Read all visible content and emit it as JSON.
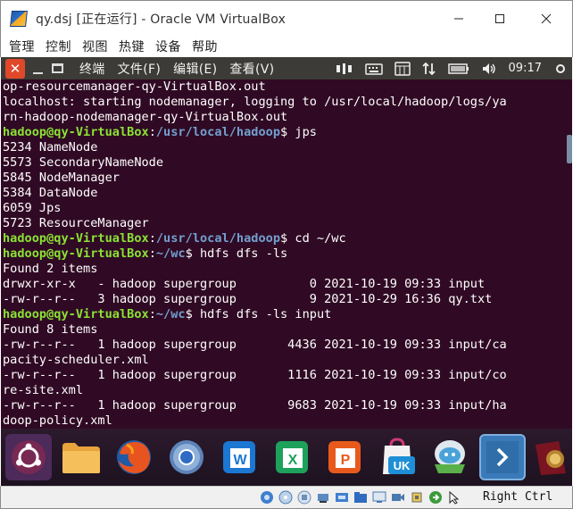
{
  "window": {
    "title": "qy.dsj [正在运行] - Oracle VM VirtualBox",
    "controls": {
      "minimize": "—",
      "maximize": "☐",
      "close": "✕"
    }
  },
  "vbox_menu": {
    "items": [
      {
        "label": "管理"
      },
      {
        "label": "控制"
      },
      {
        "label": "视图"
      },
      {
        "label": "热键"
      },
      {
        "label": "设备"
      },
      {
        "label": "帮助"
      }
    ]
  },
  "ubuntu_bar": {
    "close_label": "✕",
    "menus": [
      {
        "label": "终端"
      },
      {
        "label": "文件(F)"
      },
      {
        "label": "编辑(E)"
      },
      {
        "label": "查看(V)"
      }
    ],
    "indicators": [
      "network-icon",
      "keyboard-icon",
      "ibus-icon",
      "transfer-icon",
      "battery-icon",
      "volume-icon"
    ],
    "clock": "09:17",
    "accent": "#e0482a"
  },
  "terminal": {
    "bg": "#300a24",
    "prompt_user": "hadoop@qy-VirtualBox",
    "lines": [
      {
        "t": "out",
        "text": "op-resourcemanager-qy-VirtualBox.out"
      },
      {
        "t": "out",
        "text": "localhost: starting nodemanager, logging to /usr/local/hadoop/logs/ya"
      },
      {
        "t": "out",
        "text": "rn-hadoop-nodemanager-qy-VirtualBox.out"
      },
      {
        "t": "prompt",
        "user": "hadoop@qy-VirtualBox",
        "sep": ":",
        "path": "/usr/local/hadoop",
        "cmd": "$ jps"
      },
      {
        "t": "out",
        "text": "5234 NameNode"
      },
      {
        "t": "out",
        "text": "5573 SecondaryNameNode"
      },
      {
        "t": "out",
        "text": "5845 NodeManager"
      },
      {
        "t": "out",
        "text": "5384 DataNode"
      },
      {
        "t": "out",
        "text": "6059 Jps"
      },
      {
        "t": "out",
        "text": "5723 ResourceManager"
      },
      {
        "t": "prompt",
        "user": "hadoop@qy-VirtualBox",
        "sep": ":",
        "path": "/usr/local/hadoop",
        "cmd": "$ cd ~/wc"
      },
      {
        "t": "prompt",
        "user": "hadoop@qy-VirtualBox",
        "sep": ":",
        "path": "~/wc",
        "cmd": "$ hdfs dfs -ls"
      },
      {
        "t": "out",
        "text": "Found 2 items"
      },
      {
        "t": "out",
        "text": "drwxr-xr-x   - hadoop supergroup          0 2021-10-19 09:33 input"
      },
      {
        "t": "out",
        "text": "-rw-r--r--   3 hadoop supergroup          9 2021-10-29 16:36 qy.txt"
      },
      {
        "t": "prompt",
        "user": "hadoop@qy-VirtualBox",
        "sep": ":",
        "path": "~/wc",
        "cmd": "$ hdfs dfs -ls input"
      },
      {
        "t": "out",
        "text": "Found 8 items"
      },
      {
        "t": "out",
        "text": "-rw-r--r--   1 hadoop supergroup       4436 2021-10-19 09:33 input/ca"
      },
      {
        "t": "out",
        "text": "pacity-scheduler.xml"
      },
      {
        "t": "out",
        "text": "-rw-r--r--   1 hadoop supergroup       1116 2021-10-19 09:33 input/co"
      },
      {
        "t": "out",
        "text": "re-site.xml"
      },
      {
        "t": "out",
        "text": "-rw-r--r--   1 hadoop supergroup       9683 2021-10-19 09:33 input/ha"
      },
      {
        "t": "out",
        "text": "doop-policy.xml"
      }
    ]
  },
  "dock": {
    "items": [
      {
        "name": "ubuntu-software-icon"
      },
      {
        "name": "files-icon"
      },
      {
        "name": "firefox-icon"
      },
      {
        "name": "chromium-icon"
      },
      {
        "name": "wps-writer-icon",
        "letter": "W"
      },
      {
        "name": "wps-spreadsheet-icon",
        "letter": "X"
      },
      {
        "name": "wps-presentation-icon",
        "letter": "P"
      },
      {
        "name": "ubuntu-kylin-software-icon",
        "letter": "UK"
      },
      {
        "name": "virtualbox-guest-icon"
      },
      {
        "name": "terminal-icon"
      },
      {
        "name": "wine-icon"
      }
    ]
  },
  "statusbar": {
    "icons": [
      "hdd-icon",
      "optical-disc-icon",
      "audio-icon",
      "network-icon",
      "usb-icon",
      "shared-folder-icon",
      "display-icon",
      "video-capture-icon",
      "cpu-icon",
      "arrow-icon",
      "mouse-integration-icon"
    ],
    "host_key": "Right Ctrl"
  }
}
